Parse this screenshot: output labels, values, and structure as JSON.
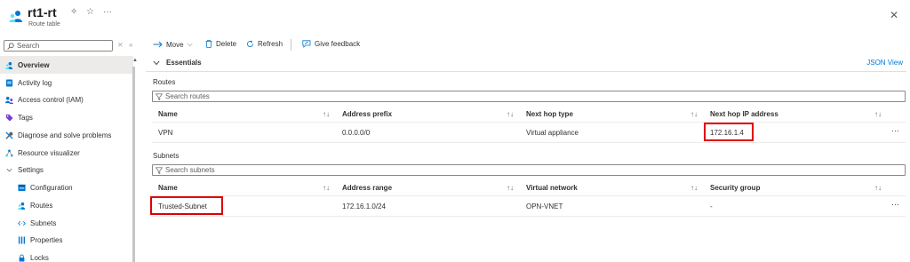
{
  "header": {
    "title": "rt1-rt",
    "subtitle": "Route table"
  },
  "sidebar": {
    "search_placeholder": "Search",
    "items": [
      {
        "label": "Overview",
        "icon": "overview-icon",
        "active": true
      },
      {
        "label": "Activity log",
        "icon": "activity-log-icon"
      },
      {
        "label": "Access control (IAM)",
        "icon": "iam-icon"
      },
      {
        "label": "Tags",
        "icon": "tag-icon"
      },
      {
        "label": "Diagnose and solve problems",
        "icon": "wrench-icon"
      },
      {
        "label": "Resource visualizer",
        "icon": "visualizer-icon"
      },
      {
        "label": "Settings",
        "icon": "chevron-down-icon"
      },
      {
        "label": "Configuration",
        "icon": "configuration-icon"
      },
      {
        "label": "Routes",
        "icon": "routes-icon"
      },
      {
        "label": "Subnets",
        "icon": "subnets-icon"
      },
      {
        "label": "Properties",
        "icon": "properties-icon"
      },
      {
        "label": "Locks",
        "icon": "lock-icon"
      }
    ]
  },
  "toolbar": {
    "move": "Move",
    "delete": "Delete",
    "refresh": "Refresh",
    "feedback": "Give feedback"
  },
  "essentials": {
    "label": "Essentials",
    "json_view": "JSON View"
  },
  "routes": {
    "title": "Routes",
    "search_placeholder": "Search routes",
    "columns": [
      "Name",
      "Address prefix",
      "Next hop type",
      "Next hop IP address"
    ],
    "rows": [
      {
        "name": "VPN",
        "prefix": "0.0.0.0/0",
        "hop_type": "Virtual appliance",
        "hop_ip": "172.16.1.4"
      }
    ]
  },
  "subnets": {
    "title": "Subnets",
    "search_placeholder": "Search subnets",
    "columns": [
      "Name",
      "Address range",
      "Virtual network",
      "Security group"
    ],
    "rows": [
      {
        "name": "Trusted-Subnet",
        "range": "172.16.1.0/24",
        "vnet": "OPN-VNET",
        "nsg": "-"
      }
    ]
  },
  "colors": {
    "accent": "#0078d4",
    "highlight": "#e00000",
    "active_bg": "#edebe9"
  }
}
